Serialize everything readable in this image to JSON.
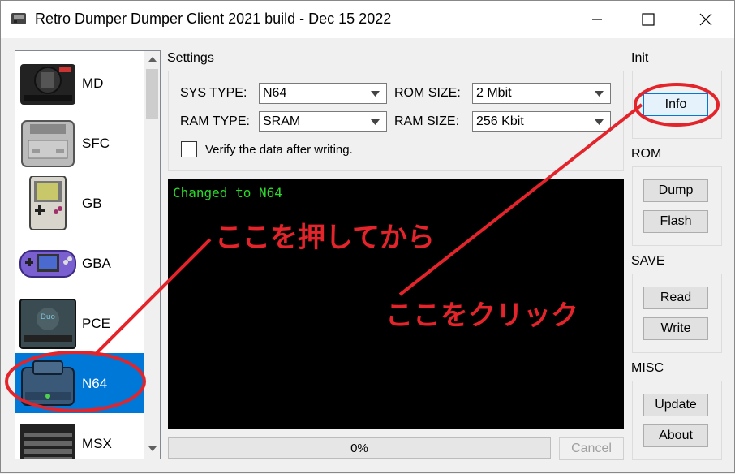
{
  "window": {
    "title": "Retro Dumper Dumper Client 2021 build - Dec 15 2022",
    "controls": {
      "minimize": "minimize-icon",
      "maximize": "maximize-icon",
      "close": "close-icon"
    }
  },
  "systems": [
    {
      "label": "MD",
      "icon": "mega-drive-icon"
    },
    {
      "label": "SFC",
      "icon": "super-famicom-icon"
    },
    {
      "label": "GB",
      "icon": "game-boy-icon"
    },
    {
      "label": "GBA",
      "icon": "game-boy-advance-icon"
    },
    {
      "label": "PCE",
      "icon": "pc-engine-icon"
    },
    {
      "label": "N64",
      "icon": "nintendo-64-icon",
      "selected": true
    },
    {
      "label": "MSX",
      "icon": "msx-icon"
    }
  ],
  "settings": {
    "group_label": "Settings",
    "sys_type_label": "SYS TYPE:",
    "sys_type_value": "N64",
    "rom_size_label": "ROM SIZE:",
    "rom_size_value": "2 Mbit",
    "ram_type_label": "RAM TYPE:",
    "ram_type_value": "SRAM",
    "ram_size_label": "RAM SIZE:",
    "ram_size_value": "256 Kbit",
    "verify_label": "Verify the data after writing.",
    "verify_checked": false
  },
  "console": {
    "lines": [
      "Changed to N64"
    ]
  },
  "progress": {
    "value": 0,
    "text": "0%"
  },
  "cancel_label": "Cancel",
  "groups": {
    "init": {
      "label": "Init",
      "buttons": [
        "Info"
      ]
    },
    "rom": {
      "label": "ROM",
      "buttons": [
        "Dump",
        "Flash"
      ]
    },
    "save": {
      "label": "SAVE",
      "buttons": [
        "Read",
        "Write"
      ]
    },
    "misc": {
      "label": "MISC",
      "buttons": [
        "Update",
        "About"
      ]
    }
  },
  "annotations": {
    "press_first": "ここを押してから",
    "click_here": "ここをクリック",
    "color": "#e3242b"
  }
}
